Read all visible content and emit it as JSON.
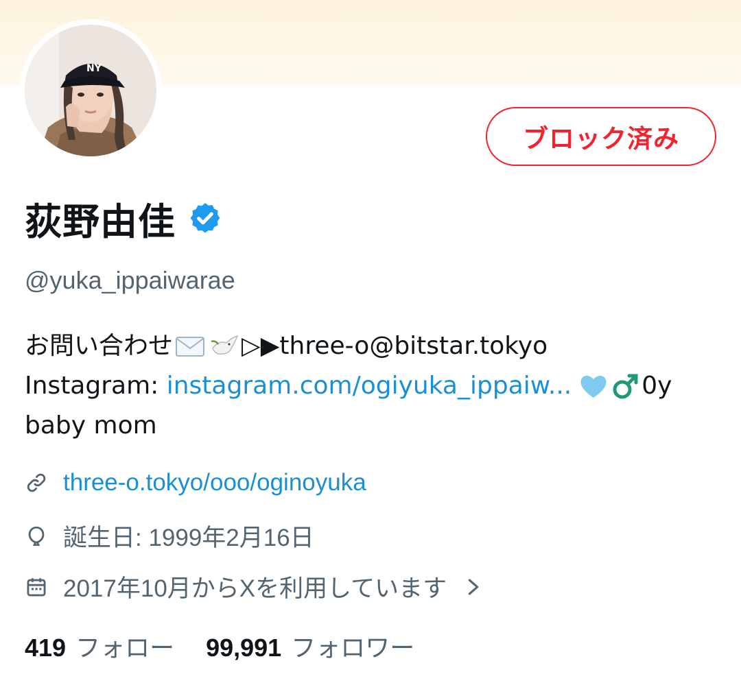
{
  "profile": {
    "name": "荻野由佳",
    "handle": "@yuka_ippaiwarae",
    "block_label": "ブロック済み",
    "verified_icon": "verified-badge-icon",
    "avatar_icon": "profile-photo"
  },
  "bio": {
    "line1_text": "お問い合わせ",
    "line1_arrows": "▷▶",
    "line1_email": "three-o@bitstar.tokyo",
    "line2_prefix": "Instagram: ",
    "line2_link": "instagram.com/ogiyuka_ippaiw...",
    "line2_suffix": "0y",
    "line3": "baby mom",
    "emoji_icons": [
      "envelope-icon",
      "dove-icon",
      "light-blue-heart-icon",
      "male-sign-icon"
    ]
  },
  "meta": {
    "website": "three-o.tokyo/ooo/oginoyuka",
    "birthday": "誕生日: 1999年2月16日",
    "joined": "2017年10月からXを利用しています"
  },
  "stats": {
    "following_count": "419",
    "following_label": "フォロー",
    "followers_count": "99,991",
    "followers_label": "フォロワー"
  },
  "colors": {
    "accent": "#1b8fd6",
    "block_red": "#f4212e",
    "muted": "#536471",
    "banner": "#fdf3de"
  }
}
